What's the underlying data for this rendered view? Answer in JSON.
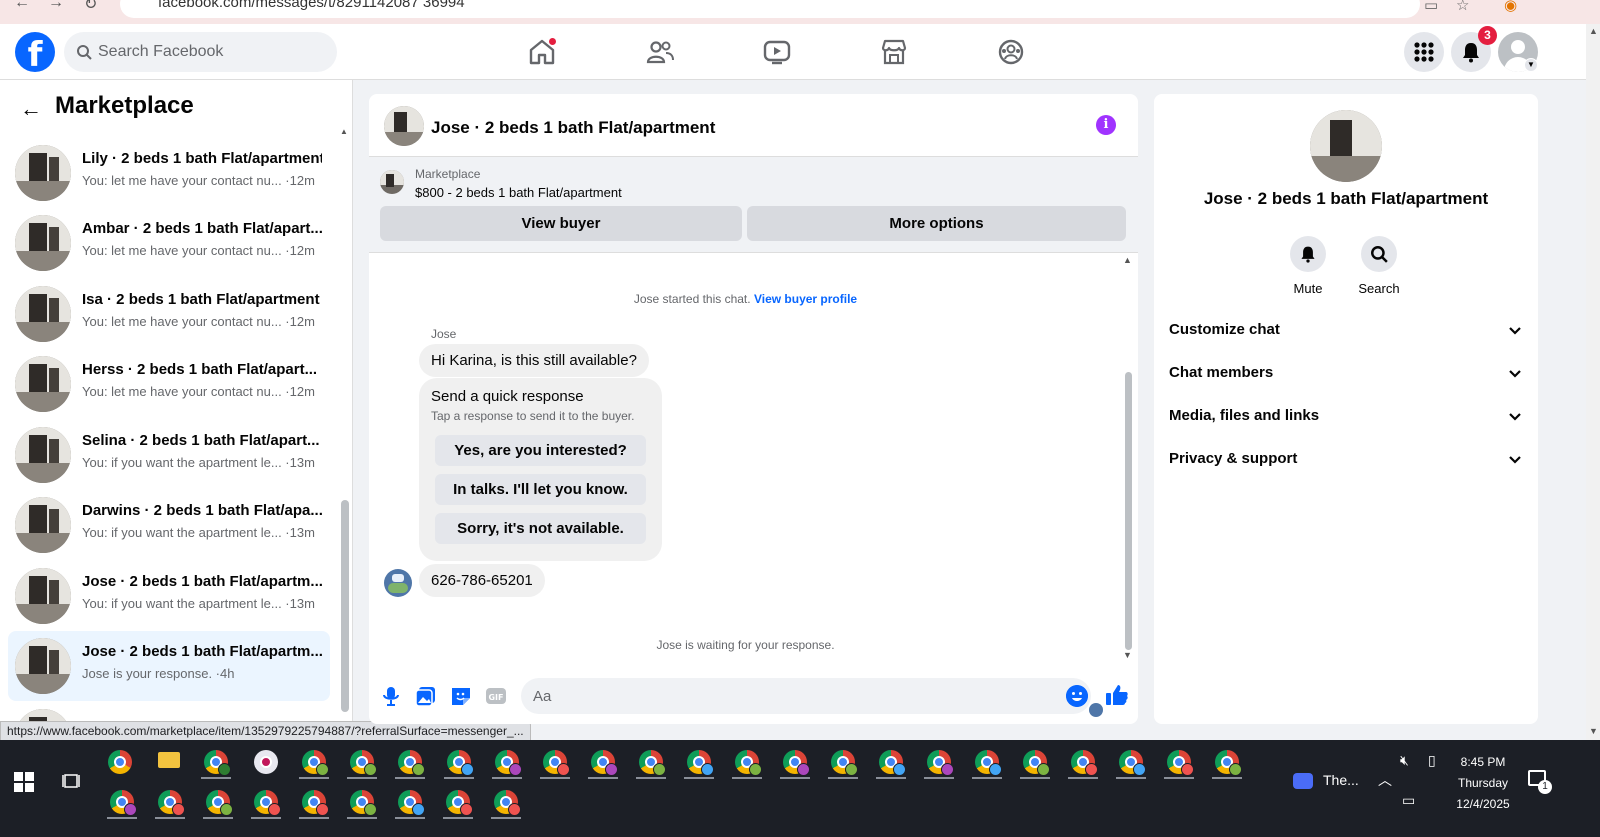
{
  "browser": {
    "url": "facebook.com/messages/t/8291142087 36994"
  },
  "header": {
    "logo_letter": "f",
    "search_placeholder": "Search Facebook",
    "notification_count": "3"
  },
  "sidebar": {
    "title": "Marketplace",
    "conversations": [
      {
        "name": "Lily · 2 beds 1 bath Flat/apartment",
        "preview": "You: let me have your contact nu... ·12m"
      },
      {
        "name": "Ambar · 2 beds 1 bath Flat/apart...",
        "preview": "You: let me have your contact nu... ·12m"
      },
      {
        "name": "Isa · 2 beds 1 bath Flat/apartment",
        "preview": "You: let me have your contact nu... ·12m"
      },
      {
        "name": "Herss · 2 beds 1 bath Flat/apart...",
        "preview": "You: let me have your contact nu... ·12m"
      },
      {
        "name": "Selina · 2 beds 1 bath Flat/apart...",
        "preview": "You: if you want the apartment le... ·13m"
      },
      {
        "name": "Darwins · 2 beds 1 bath Flat/apa...",
        "preview": "You: if you want the apartment le... ·13m"
      },
      {
        "name": "Jose · 2 beds 1 bath Flat/apartm...",
        "preview": "You: if you want the apartment le... ·13m"
      },
      {
        "name": "Jose · 2 beds 1 bath Flat/apartm...",
        "preview": "Jose is your response. ·4h"
      }
    ]
  },
  "status_url": "https://www.facebook.com/marketplace/item/1352979225794887/?referralSurface=messenger_...",
  "chat": {
    "title": "Jose · 2 beds 1 bath Flat/apartment",
    "info_glyph": "i",
    "marketplace_label": "Marketplace",
    "listing": "$800 - 2 beds 1 bath Flat/apartment",
    "view_buyer": "View buyer",
    "more_options": "More options",
    "started_text": "Jose started this chat.",
    "view_buyer_profile": "View buyer profile",
    "sender": "Jose",
    "message_1": "Hi Karina, is this still available?",
    "quick_title": "Send a quick response",
    "quick_sub": "Tap a response to send it to the buyer.",
    "quick_options": [
      "Yes, are you interested?",
      "In talks. I'll let you know.",
      "Sorry, it's not available."
    ],
    "message_2": "626-786-65201",
    "waiting": "Jose is waiting for your response.",
    "composer_placeholder": "Aa"
  },
  "info_panel": {
    "name": "Jose · 2 beds 1 bath Flat/apartment",
    "mute": "Mute",
    "search": "Search",
    "sections": [
      "Customize chat",
      "Chat members",
      "Media, files and links",
      "Privacy & support"
    ]
  },
  "taskbar": {
    "zoom_label": "The...",
    "time": "8:45 PM",
    "day": "Thursday",
    "date": "12/4/2025",
    "notif_count": "1"
  }
}
